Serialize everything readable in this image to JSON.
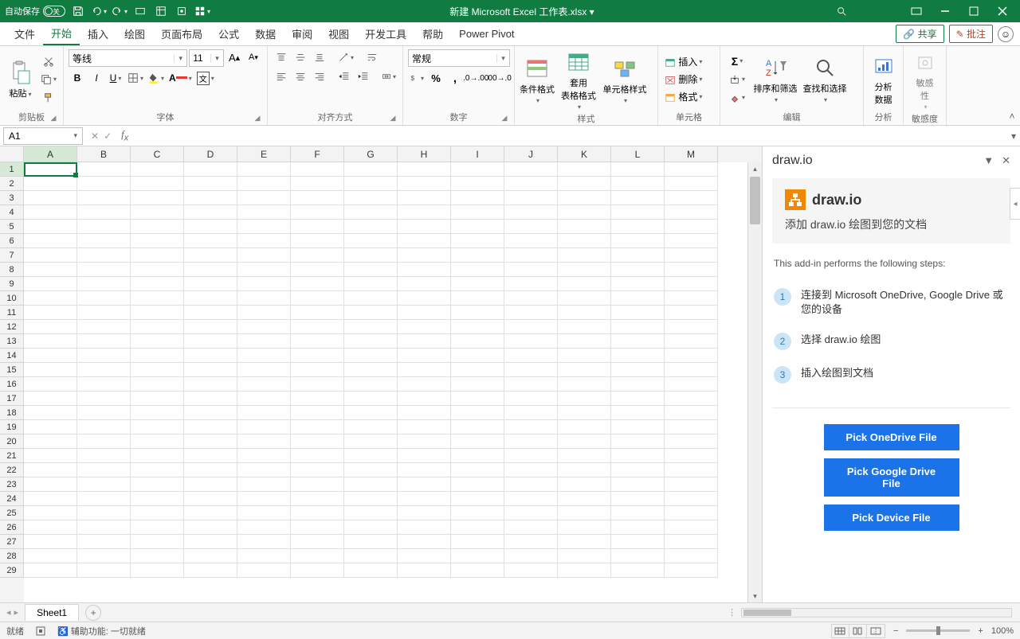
{
  "titlebar": {
    "autosave_label": "自动保存",
    "autosave_state": "关",
    "filename": "新建 Microsoft Excel 工作表.xlsx",
    "filename_suffix": "▾"
  },
  "tabs": {
    "items": [
      "文件",
      "开始",
      "插入",
      "绘图",
      "页面布局",
      "公式",
      "数据",
      "审阅",
      "视图",
      "开发工具",
      "帮助",
      "Power Pivot"
    ],
    "active_index": 1,
    "share": "共享",
    "comment": "批注"
  },
  "ribbon": {
    "clipboard": {
      "paste": "粘贴",
      "label": "剪贴板"
    },
    "font": {
      "name": "等线",
      "size": "11",
      "label": "字体"
    },
    "align": {
      "label": "对齐方式"
    },
    "number": {
      "format": "常规",
      "label": "数字"
    },
    "styles": {
      "cond": "条件格式",
      "table": "套用\n表格格式",
      "cell": "单元格样式",
      "label": "样式"
    },
    "cells": {
      "insert": "插入",
      "delete": "删除",
      "format": "格式",
      "label": "单元格"
    },
    "editing": {
      "sort": "排序和筛选",
      "find": "查找和选择",
      "label": "编辑"
    },
    "analysis": {
      "analyze": "分析\n数据",
      "label": "分析"
    },
    "sensitivity": {
      "btn": "敏感\n性",
      "label": "敏感度"
    }
  },
  "namebox": {
    "cell": "A1"
  },
  "grid": {
    "cols": [
      "A",
      "B",
      "C",
      "D",
      "E",
      "F",
      "G",
      "H",
      "I",
      "J",
      "K",
      "L",
      "M"
    ],
    "rows": 29
  },
  "sidepane": {
    "title": "draw.io",
    "brand": "draw.io",
    "banner_sub": "添加 draw.io 绘图到您的文档",
    "intro": "This add-in performs the following steps:",
    "steps": [
      "连接到 Microsoft OneDrive, Google Drive 或您的设备",
      "选择 draw.io 绘图",
      "插入绘图到文档"
    ],
    "buttons": [
      "Pick OneDrive File",
      "Pick Google Drive File",
      "Pick Device File"
    ]
  },
  "sheettabs": {
    "active": "Sheet1"
  },
  "status": {
    "ready": "就绪",
    "access": "辅助功能: 一切就绪",
    "zoom": "100%"
  }
}
